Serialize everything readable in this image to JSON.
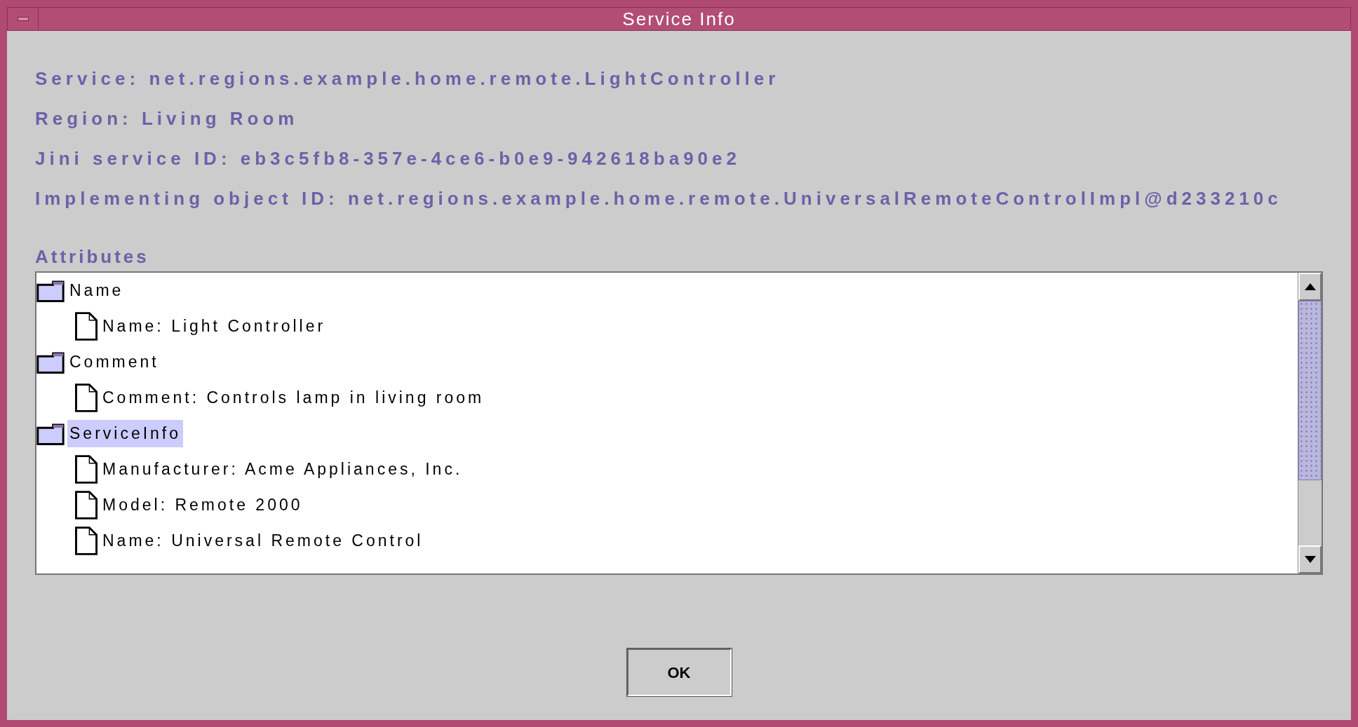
{
  "window": {
    "title": "Service Info"
  },
  "info_lines": [
    "Service: net.regions.example.home.remote.LightController",
    "Region: Living Room",
    "Jini service ID: eb3c5fb8-357e-4ce6-b0e9-942618ba90e2",
    "Implementing object ID: net.regions.example.home.remote.UniversalRemoteControlImpl@d233210c"
  ],
  "attributes": {
    "label": "Attributes",
    "tree": [
      {
        "label": "Name",
        "selected": false,
        "children": [
          {
            "label": "Name: Light Controller",
            "selected": false
          }
        ]
      },
      {
        "label": "Comment",
        "selected": false,
        "children": [
          {
            "label": "Comment: Controls lamp in living room",
            "selected": false
          }
        ]
      },
      {
        "label": "ServiceInfo",
        "selected": true,
        "children": [
          {
            "label": "Manufacturer: Acme Appliances, Inc.",
            "selected": false
          },
          {
            "label": "Model: Remote 2000",
            "selected": false
          },
          {
            "label": "Name: Universal Remote Control",
            "selected": false
          }
        ]
      }
    ]
  },
  "buttons": [
    "OK"
  ]
}
